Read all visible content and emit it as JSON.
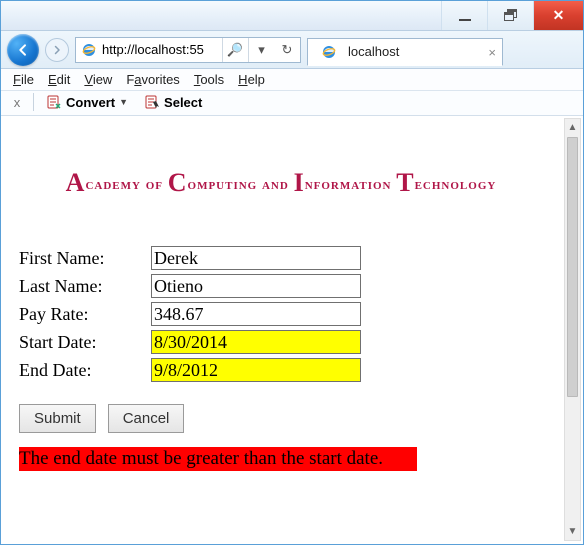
{
  "window": {
    "min": "–",
    "max": "❐",
    "close": "✕"
  },
  "nav": {
    "url": "http://localhost:55",
    "search_glyph": "🔍",
    "dropdown_glyph": "▾",
    "refresh_glyph": "↻"
  },
  "tab": {
    "title": "localhost",
    "close": "×"
  },
  "menus": {
    "file": "File",
    "edit": "Edit",
    "view": "View",
    "favorites": "Favorites",
    "tools": "Tools",
    "help": "Help"
  },
  "toolbar": {
    "x": "x",
    "convert": "Convert",
    "select": "Select",
    "dd": "▼"
  },
  "heading": {
    "word1_big": "A",
    "word1_rest": "cademy of ",
    "word2_big": "C",
    "word2_rest": "omputing and ",
    "word3_big": "I",
    "word3_rest": "nformation ",
    "word4_big": "T",
    "word4_rest": "echnology"
  },
  "form": {
    "labels": {
      "first_name": "First Name:",
      "last_name": "Last Name:",
      "pay_rate": "Pay Rate:",
      "start_date": "Start Date:",
      "end_date": "End Date:"
    },
    "values": {
      "first_name": "Derek",
      "last_name": "Otieno",
      "pay_rate": "348.67",
      "start_date": "8/30/2014",
      "end_date": "9/8/2012"
    },
    "buttons": {
      "submit": "Submit",
      "cancel": "Cancel"
    }
  },
  "error": "The end date must be greater than the start date.",
  "scroll": {
    "up": "▲",
    "down": "▼"
  }
}
